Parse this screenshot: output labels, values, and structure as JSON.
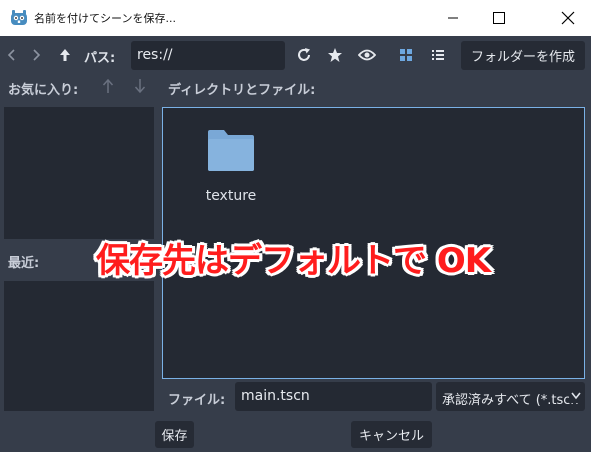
{
  "window": {
    "title": "名前を付けてシーンを保存..."
  },
  "toolbar": {
    "path_label": "パス:",
    "path_value": "res://",
    "new_folder_label": "フォルダーを作成"
  },
  "sidebar": {
    "favorites_label": "お気に入り:",
    "recent_label": "最近:"
  },
  "browser": {
    "dir_label": "ディレクトリとファイル:",
    "items": [
      {
        "name": "texture",
        "icon": "folder-icon"
      }
    ]
  },
  "bottom": {
    "file_label": "ファイル:",
    "filename_value": "main.tscn",
    "filter_selected": "承認済みすべて (*.tscn",
    "save_label": "保存",
    "cancel_label": "キャンセル"
  },
  "annotation": {
    "text": "保存先はデフォルトで OK",
    "color": "#ff1d1d"
  },
  "colors": {
    "background": "#363d4a",
    "field": "#242933",
    "accent": "#7ab1e6",
    "folder": "#7aa8d6"
  }
}
